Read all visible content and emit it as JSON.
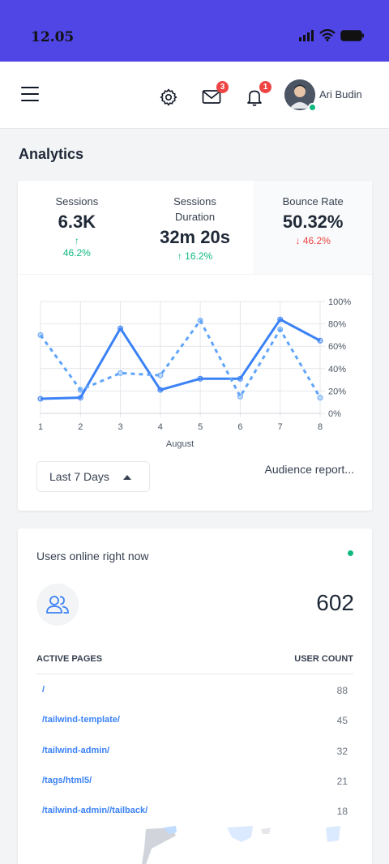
{
  "status_bar": {
    "time": "12.05"
  },
  "header": {
    "mail_badge": "3",
    "notification_badge": "1",
    "username": "Ari Budin"
  },
  "page": {
    "title": "Analytics"
  },
  "stats": [
    {
      "label_line1": "Sessions",
      "label_line2": "",
      "value": "6.3K",
      "delta": "↑",
      "delta2": "46.2%",
      "trend": "up"
    },
    {
      "label_line1": "Sessions",
      "label_line2": "Duration",
      "value": "32m 20s",
      "delta": "↑  16.2%",
      "delta2": "",
      "trend": "up"
    },
    {
      "label_line1": "Bounce Rate",
      "label_line2": "",
      "value": "50.32%",
      "delta": "↓  46.2%",
      "delta2": "",
      "trend": "down"
    }
  ],
  "chart_data": {
    "type": "line",
    "x": [
      1,
      2,
      3,
      4,
      5,
      6,
      7,
      8
    ],
    "xlabel": "August",
    "ylabel": "",
    "ylim": [
      0,
      100
    ],
    "yticks": [
      "0%",
      "20%",
      "40%",
      "60%",
      "80%",
      "100%"
    ],
    "grid": true,
    "series": [
      {
        "style": "solid",
        "color": "#3b82f6",
        "values": [
          13,
          14,
          76,
          21,
          31,
          31,
          84,
          65
        ]
      },
      {
        "style": "dashed",
        "color": "#60a5fa",
        "values": [
          70,
          21,
          36,
          34,
          83,
          15,
          75,
          14
        ]
      }
    ]
  },
  "controls": {
    "range_select": "Last 7 Days",
    "report_link": "Audience report..."
  },
  "online": {
    "title": "Users online right now",
    "count": "602",
    "col_page": "ACTIVE PAGES",
    "col_count": "USER COUNT",
    "rows": [
      {
        "page": "/",
        "count": "88"
      },
      {
        "page": "/tailwind-template/",
        "count": "45"
      },
      {
        "page": "/tailwind-admin/",
        "count": "32"
      },
      {
        "page": "/tags/html5/",
        "count": "21"
      },
      {
        "page": "/tailwind-admin//tailback/",
        "count": "18"
      }
    ]
  },
  "colors": {
    "status_bar": "#4f46e5",
    "accent": "#3b82f6",
    "up": "#10b981",
    "down": "#ef4444"
  }
}
